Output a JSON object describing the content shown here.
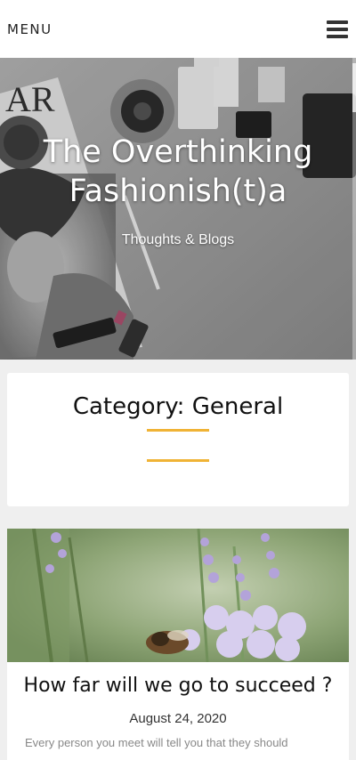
{
  "header": {
    "menu_label": "MENU"
  },
  "hero": {
    "title_line1": "The Overthinking",
    "title_line2": "Fashionish(t)a",
    "tagline": "Thoughts & Blogs",
    "magazine_text": "AR"
  },
  "category": {
    "heading": "Category: General",
    "accent_color": "#f0b335"
  },
  "post": {
    "title": "How far will we go to succeed ?",
    "date": "August 24, 2020",
    "excerpt": "Every person you meet will tell you that they should"
  }
}
